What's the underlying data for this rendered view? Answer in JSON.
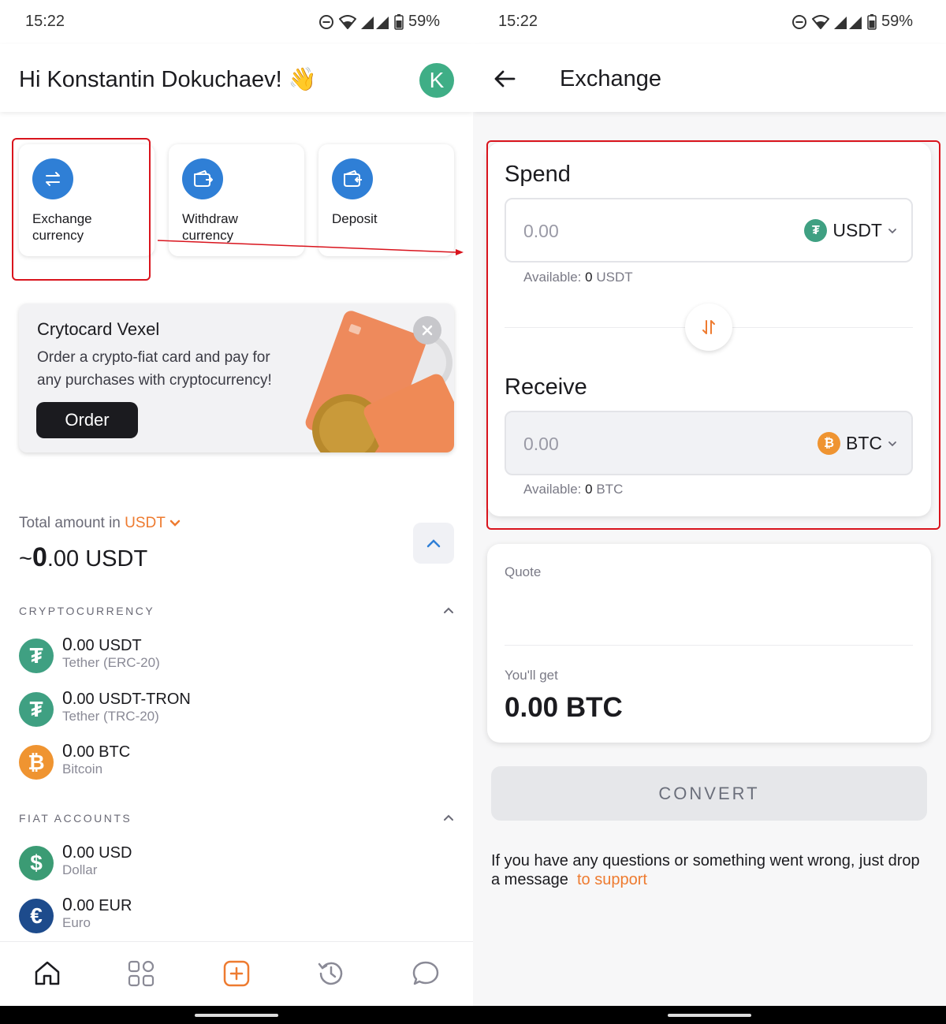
{
  "status": {
    "time": "15:22",
    "battery": "59%"
  },
  "left": {
    "greeting": "Hi Konstantin Dokuchaev! 👋",
    "avatar_letter": "K",
    "actions": [
      {
        "label": "Exchange currency",
        "icon": "exchange-icon"
      },
      {
        "label": "Withdraw currency",
        "icon": "wallet-out-icon"
      },
      {
        "label": "Deposit",
        "icon": "wallet-in-icon"
      }
    ],
    "promo": {
      "title": "Crytocard Vexel",
      "desc": "Order a crypto-fiat card and pay for any purchases with cryptocurrency!",
      "order_label": "Order"
    },
    "total": {
      "label": "Total amount in",
      "currency": "USDT",
      "prefix": "~",
      "int": "0",
      "dec": ".00 USDT"
    },
    "crypto_title": "CRYPTOCURRENCY",
    "crypto": [
      {
        "int": "0",
        "rest": ".00 USDT",
        "name": "Tether (ERC-20)",
        "color": "#3fa082",
        "symbol": "₮"
      },
      {
        "int": "0",
        "rest": ".00 USDT-TRON",
        "name": "Tether (TRC-20)",
        "color": "#3fa082",
        "symbol": "₮"
      },
      {
        "int": "0",
        "rest": ".00 BTC",
        "name": "Bitcoin",
        "color": "#ef9431",
        "symbol": "₿"
      }
    ],
    "fiat_title": "FIAT ACCOUNTS",
    "fiat": [
      {
        "int": "0",
        "rest": ".00 USD",
        "name": "Dollar",
        "color": "#3b9b74",
        "symbol": "$"
      },
      {
        "int": "0",
        "rest": ".00 EUR",
        "name": "Euro",
        "color": "#1d4b8c",
        "symbol": "€"
      }
    ],
    "nav": [
      "home-icon",
      "apps-icon",
      "add-icon",
      "history-icon",
      "chat-icon"
    ],
    "accent": "#ee7b30",
    "highlight": "#d9141d"
  },
  "right": {
    "title": "Exchange",
    "spend_title": "Spend",
    "spend_value": "0.00",
    "spend_currency": "USDT",
    "spend_available_label": "Available:",
    "spend_available_amount": "0",
    "spend_available_cur": "USDT",
    "receive_title": "Receive",
    "receive_value": "0.00",
    "receive_currency": "BTC",
    "receive_available_label": "Available:",
    "receive_available_amount": "0",
    "receive_available_cur": "BTC",
    "quote_label": "Quote",
    "get_label": "You'll get",
    "get_value": "0.00 BTC",
    "convert_label": "CONVERT",
    "help_text": "If you have any questions or something went wrong, just drop a message",
    "help_link": "to support"
  }
}
